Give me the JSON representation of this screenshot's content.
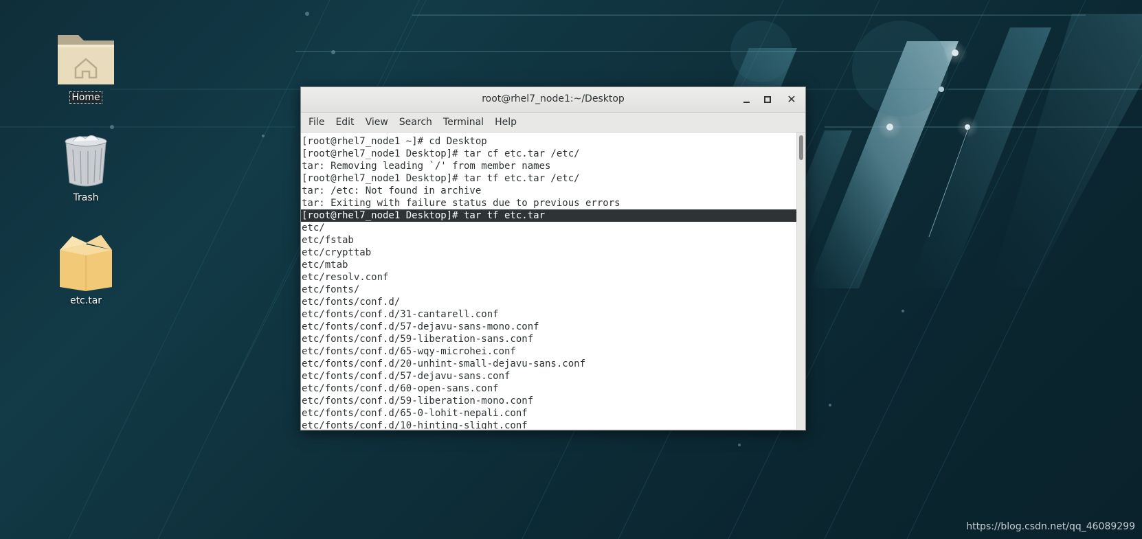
{
  "desktop": {
    "icons": [
      {
        "label": "Home",
        "icon": "home-folder-icon"
      },
      {
        "label": "Trash",
        "icon": "trash-icon"
      },
      {
        "label": "etc.tar",
        "icon": "archive-box-icon"
      }
    ],
    "watermark": "https://blog.csdn.net/qq_46089299"
  },
  "terminal": {
    "title": "root@rhel7_node1:~/Desktop",
    "window_buttons": [
      "minimize",
      "maximize",
      "close"
    ],
    "menu": [
      "File",
      "Edit",
      "View",
      "Search",
      "Terminal",
      "Help"
    ],
    "lines": [
      "[root@rhel7_node1 ~]# cd Desktop",
      "[root@rhel7_node1 Desktop]# tar cf etc.tar /etc/",
      "tar: Removing leading `/' from member names",
      "[root@rhel7_node1 Desktop]# tar tf etc.tar /etc/",
      "tar: /etc: Not found in archive",
      "tar: Exiting with failure status due to previous errors",
      "[root@rhel7_node1 Desktop]# tar tf etc.tar",
      "etc/",
      "etc/fstab",
      "etc/crypttab",
      "etc/mtab",
      "etc/resolv.conf",
      "etc/fonts/",
      "etc/fonts/conf.d/",
      "etc/fonts/conf.d/31-cantarell.conf",
      "etc/fonts/conf.d/57-dejavu-sans-mono.conf",
      "etc/fonts/conf.d/59-liberation-sans.conf",
      "etc/fonts/conf.d/65-wqy-microhei.conf",
      "etc/fonts/conf.d/20-unhint-small-dejavu-sans.conf",
      "etc/fonts/conf.d/57-dejavu-sans.conf",
      "etc/fonts/conf.d/60-open-sans.conf",
      "etc/fonts/conf.d/59-liberation-mono.conf",
      "etc/fonts/conf.d/65-0-lohit-nepali.conf",
      "etc/fonts/conf.d/10-hinting-slight.conf"
    ],
    "highlighted_line": 6
  },
  "colors": {
    "terminal_text": "#2e3436",
    "terminal_bg": "#ffffff",
    "chrome_bg": "#e8e8e7",
    "highlight_bg": "#2e3436"
  }
}
